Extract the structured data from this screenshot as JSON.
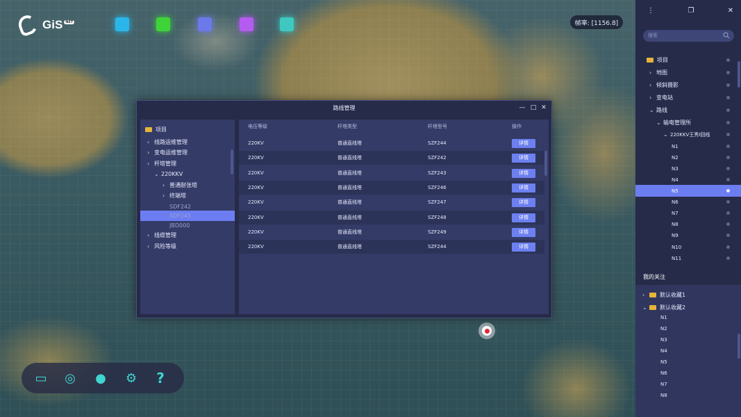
{
  "app": {
    "logo_text": "GiS",
    "logo_badge": "NET",
    "fps": "帧率: [1156.8]"
  },
  "toolbar": [
    {
      "name": "layers-tool",
      "color": "#2bb6ea"
    },
    {
      "name": "grid-tool",
      "color": "#3fd33a"
    },
    {
      "name": "location-tool",
      "color": "#6b79e9"
    },
    {
      "name": "cube-tool",
      "color": "#b45cf0"
    },
    {
      "name": "panel-tool",
      "color": "#3ec8c0"
    }
  ],
  "bottombar": [
    "battery-icon",
    "target-pin-icon",
    "pin-icon",
    "settings-icon",
    "help-icon"
  ],
  "dialog": {
    "title": "路线管理",
    "tree": {
      "root": "项目",
      "items": [
        {
          "label": "线路运维管理",
          "arrow": ">",
          "level": 1
        },
        {
          "label": "变电运维管理",
          "arrow": ">",
          "level": 1
        },
        {
          "label": "杆塔管理",
          "arrow": ">",
          "level": 1
        },
        {
          "label": "220KKV",
          "arrow": "v",
          "level": 2
        },
        {
          "label": "普通耐张塔",
          "arrow": ">",
          "level": 3
        },
        {
          "label": "终端塔",
          "arrow": ">",
          "level": 3
        },
        {
          "label": "SDF242",
          "arrow": "",
          "level": 3
        },
        {
          "label": "SDF241",
          "arrow": "",
          "level": 3,
          "selected": true
        },
        {
          "label": "JBD000",
          "arrow": "",
          "level": 3
        },
        {
          "label": "线缆管理",
          "arrow": ">",
          "level": 1
        },
        {
          "label": "风险等级",
          "arrow": ">",
          "level": 1
        }
      ]
    },
    "columns": [
      "电压等级",
      "杆塔类型",
      "杆塔型号",
      "操作"
    ],
    "rows": [
      [
        "220KV",
        "普通直线塔",
        "SZF244"
      ],
      [
        "220KV",
        "普通直线塔",
        "SZF242"
      ],
      [
        "220KV",
        "普通直线塔",
        "SZF243"
      ],
      [
        "220KV",
        "普通直线塔",
        "SZF246"
      ],
      [
        "220KV",
        "普通直线塔",
        "SZF247"
      ],
      [
        "220KV",
        "普通直线塔",
        "SZF248"
      ],
      [
        "220KV",
        "普通直线塔",
        "SZF249"
      ],
      [
        "220KV",
        "普通直线塔",
        "SZF244"
      ]
    ],
    "detail_label": "详情"
  },
  "panel": {
    "search_placeholder": "搜索",
    "tree": [
      {
        "label": "项目",
        "arrow": "",
        "folder": true,
        "level": 0
      },
      {
        "label": "地图",
        "arrow": ">",
        "level": 1
      },
      {
        "label": "倾斜摄影",
        "arrow": ">",
        "level": 1
      },
      {
        "label": "变电站",
        "arrow": ">",
        "level": 1
      },
      {
        "label": "路线",
        "arrow": "v",
        "level": 1
      },
      {
        "label": "输电管理所",
        "arrow": "v",
        "level": 2
      },
      {
        "label": "220KKV王秀Ⅰ回线",
        "arrow": "v",
        "level": 3
      },
      {
        "label": "N1",
        "arrow": "",
        "level": 4
      },
      {
        "label": "N2",
        "arrow": "",
        "level": 4
      },
      {
        "label": "N3",
        "arrow": "",
        "level": 4
      },
      {
        "label": "N4",
        "arrow": "",
        "level": 4
      },
      {
        "label": "N5",
        "arrow": "",
        "level": 4,
        "selected": true
      },
      {
        "label": "N6",
        "arrow": "",
        "level": 4
      },
      {
        "label": "N7",
        "arrow": "",
        "level": 4
      },
      {
        "label": "N8",
        "arrow": "",
        "level": 4
      },
      {
        "label": "N9",
        "arrow": "",
        "level": 4
      },
      {
        "label": "N10",
        "arrow": "",
        "level": 4
      },
      {
        "label": "N11",
        "arrow": "",
        "level": 4
      }
    ],
    "favorites_title": "我的关注",
    "favorites": [
      {
        "label": "默认收藏1",
        "arrow": ">"
      },
      {
        "label": "默认收藏2",
        "arrow": "v"
      }
    ],
    "fav_items": [
      "N1",
      "N2",
      "N3",
      "N4",
      "N5",
      "N6",
      "N7",
      "N8"
    ]
  }
}
